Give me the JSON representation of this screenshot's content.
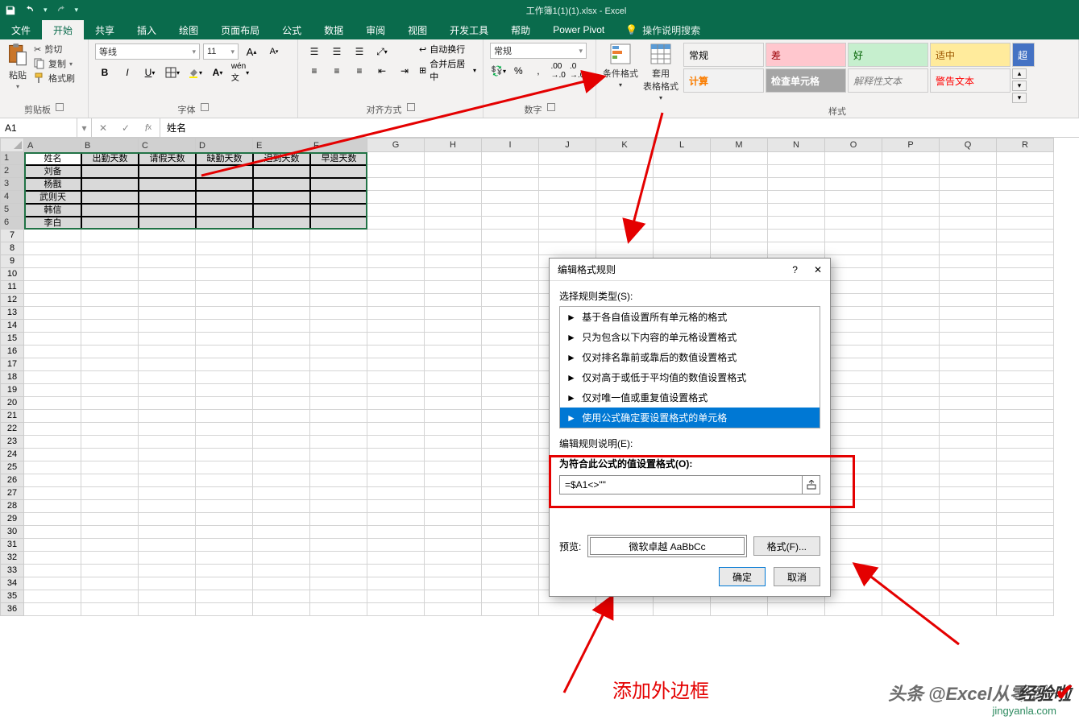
{
  "window": {
    "title": "工作簿1(1)(1).xlsx - Excel"
  },
  "tabs": {
    "file": "文件",
    "home": "开始",
    "share": "共享",
    "insert": "插入",
    "draw": "绘图",
    "layout": "页面布局",
    "formulas": "公式",
    "data": "数据",
    "review": "审阅",
    "view": "视图",
    "developer": "开发工具",
    "help": "帮助",
    "powerpivot": "Power Pivot",
    "tellme": "操作说明搜索"
  },
  "ribbon": {
    "clipboard": {
      "paste": "粘贴",
      "cut": "剪切",
      "copy": "复制",
      "painter": "格式刷",
      "label": "剪贴板"
    },
    "font_group": {
      "font": "等线",
      "size": "11",
      "label": "字体"
    },
    "align": {
      "wrap": "自动换行",
      "merge": "合并后居中",
      "label": "对齐方式"
    },
    "number": {
      "format": "常规",
      "label": "数字"
    },
    "styles": {
      "conditional": "条件格式",
      "tableformat": "套用\n表格格式",
      "s1": "常规",
      "s2": "差",
      "s3": "好",
      "s4": "适中",
      "s5": "计算",
      "s6": "检查单元格",
      "s7": "解释性文本",
      "s8": "警告文本",
      "s9": "超",
      "label": "样式"
    }
  },
  "formula_bar": {
    "name": "A1",
    "value": "姓名"
  },
  "columns": [
    "A",
    "B",
    "C",
    "D",
    "E",
    "F",
    "G",
    "H",
    "I",
    "J",
    "K",
    "L",
    "M",
    "N",
    "O",
    "P",
    "Q",
    "R"
  ],
  "sheet": {
    "headers": [
      "姓名",
      "出勤天数",
      "请假天数",
      "缺勤天数",
      "迟到天数",
      "早退天数"
    ],
    "rows": [
      "刘备",
      "杨戬",
      "武则天",
      "韩信",
      "李白"
    ]
  },
  "dialog": {
    "title": "编辑格式规则",
    "select_type": "选择规则类型(S):",
    "types": [
      "基于各自值设置所有单元格的格式",
      "只为包含以下内容的单元格设置格式",
      "仅对排名靠前或靠后的数值设置格式",
      "仅对高于或低于平均值的数值设置格式",
      "仅对唯一值或重复值设置格式",
      "使用公式确定要设置格式的单元格"
    ],
    "edit_desc": "编辑规则说明(E):",
    "formula_label": "为符合此公式的值设置格式(O):",
    "formula": "=$A1<>\"\"",
    "preview_label": "预览:",
    "preview_text": "微软卓越 AaBbCc",
    "format_btn": "格式(F)...",
    "ok": "确定",
    "cancel": "取消"
  },
  "annotation": {
    "text": "添加外边框"
  },
  "watermark": {
    "main": "头条 @Excel从零到一",
    "site": "jingyanla.com",
    "jy": "经验啦"
  }
}
